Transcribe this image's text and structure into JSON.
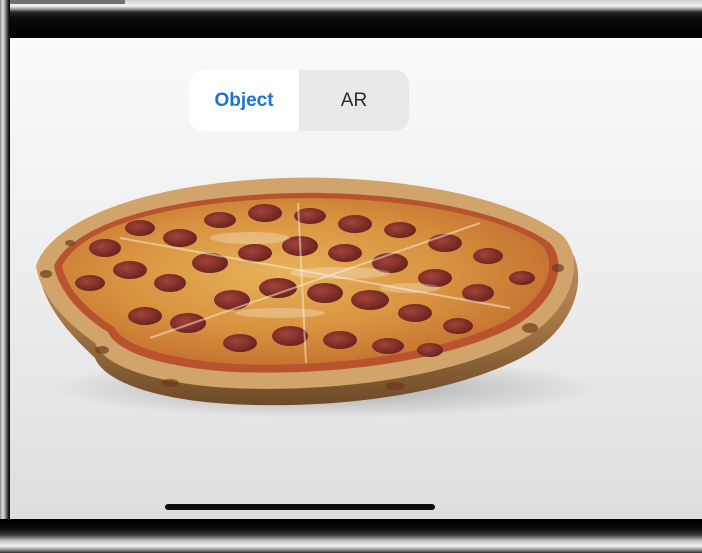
{
  "viewer": {
    "segments": [
      {
        "label": "Object",
        "selected": true
      },
      {
        "label": "AR",
        "selected": false
      }
    ],
    "accent_color": "#1a73d9",
    "model": "pepperoni-pizza"
  }
}
